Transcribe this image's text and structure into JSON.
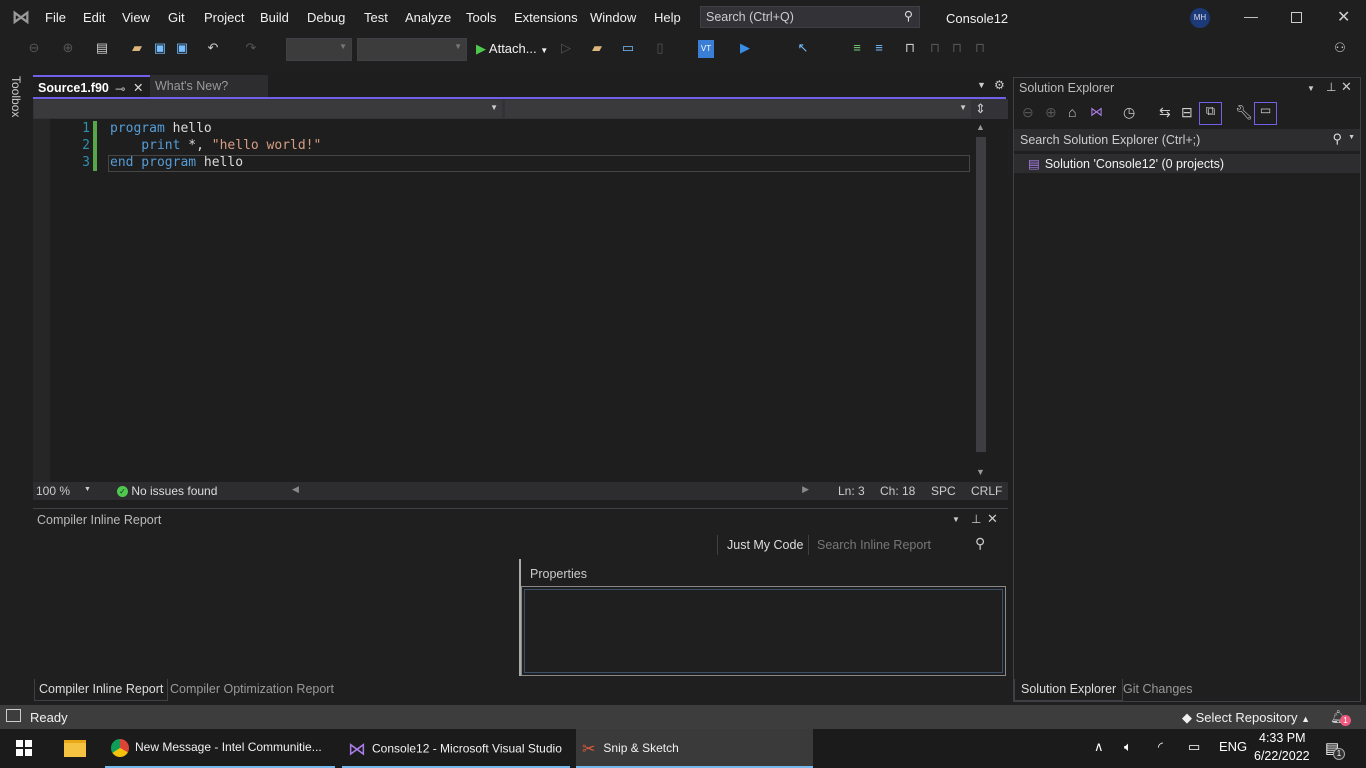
{
  "window": {
    "title": "Console12",
    "user_initials": "MH"
  },
  "menu": [
    "File",
    "Edit",
    "View",
    "Git",
    "Project",
    "Build",
    "Debug",
    "Test",
    "Analyze",
    "Tools",
    "Extensions",
    "Window",
    "Help"
  ],
  "search": {
    "placeholder": "Search (Ctrl+Q)"
  },
  "toolbar": {
    "attach_label": "Attach...",
    "config_value": "",
    "platform_value": ""
  },
  "toolbox_label": "Toolbox",
  "tabs": [
    {
      "label": "Source1.f90",
      "active": true
    },
    {
      "label": "What's New?",
      "active": false
    }
  ],
  "editor": {
    "lines": [
      {
        "num": "1",
        "tokens": [
          {
            "t": "program",
            "c": "kw"
          },
          {
            "t": " hello",
            "c": "id"
          }
        ]
      },
      {
        "num": "2",
        "tokens": [
          {
            "t": "    print",
            "c": "kw"
          },
          {
            "t": " *, ",
            "c": "id"
          },
          {
            "t": "\"hello world!\"",
            "c": "str"
          }
        ]
      },
      {
        "num": "3",
        "tokens": [
          {
            "t": "end program",
            "c": "kw"
          },
          {
            "t": " hello",
            "c": "id"
          }
        ]
      }
    ],
    "zoom": "100 %",
    "issues": "No issues found",
    "line": "Ln: 3",
    "col": "Ch: 18",
    "whitespace": "SPC",
    "eol": "CRLF"
  },
  "report": {
    "title": "Compiler Inline Report",
    "just_my_code": "Just My Code",
    "search_placeholder": "Search Inline Report",
    "properties_label": "Properties",
    "bottom_tabs": [
      "Compiler Inline Report",
      "Compiler Optimization Report"
    ]
  },
  "solution_explorer": {
    "title": "Solution Explorer",
    "search_placeholder": "Search Solution Explorer (Ctrl+;)",
    "root": "Solution 'Console12' (0 projects)",
    "bottom_tabs": [
      "Solution Explorer",
      "Git Changes"
    ]
  },
  "statusbar": {
    "state": "Ready",
    "repo": "Select Repository",
    "notifications": "1"
  },
  "taskbar": {
    "apps": [
      {
        "label": "New Message - Intel Communitie..."
      },
      {
        "label": "Console12 - Microsoft Visual Studio"
      },
      {
        "label": "Snip & Sketch"
      }
    ],
    "lang": "ENG",
    "time": "4:33 PM",
    "date": "6/22/2022",
    "action_center_count": "1"
  }
}
